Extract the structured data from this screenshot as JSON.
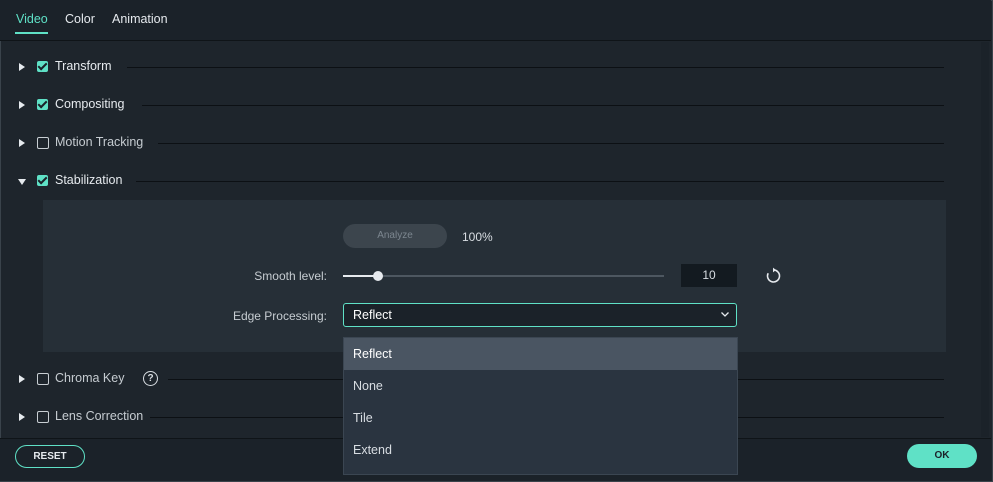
{
  "tabs": [
    {
      "label": "Video",
      "active": true
    },
    {
      "label": "Color",
      "active": false
    },
    {
      "label": "Animation",
      "active": false
    }
  ],
  "sections": {
    "transform": {
      "label": "Transform",
      "checked": true,
      "expanded": false
    },
    "compositing": {
      "label": "Compositing",
      "checked": true,
      "expanded": false
    },
    "motion_tracking": {
      "label": "Motion Tracking",
      "checked": false,
      "expanded": false
    },
    "stabilization": {
      "label": "Stabilization",
      "checked": true,
      "expanded": true
    },
    "chroma_key": {
      "label": "Chroma Key",
      "checked": false,
      "expanded": false
    },
    "lens_correction": {
      "label": "Lens Correction",
      "checked": false,
      "expanded": false
    }
  },
  "stabilization": {
    "analyze_label": "Analyze",
    "analyze_progress": "100%",
    "smooth_level_label": "Smooth level:",
    "smooth_level_value": "10",
    "smooth_level_fraction": 0.11,
    "edge_processing_label": "Edge Processing:",
    "edge_processing_selected": "Reflect",
    "edge_processing_options": [
      "Reflect",
      "None",
      "Tile",
      "Extend"
    ]
  },
  "help_glyph": "?",
  "footer": {
    "reset_label": "RESET",
    "ok_label": "OK"
  },
  "colors": {
    "accent": "#5fe1c6",
    "background": "#1e252c",
    "panel": "#262f37"
  }
}
